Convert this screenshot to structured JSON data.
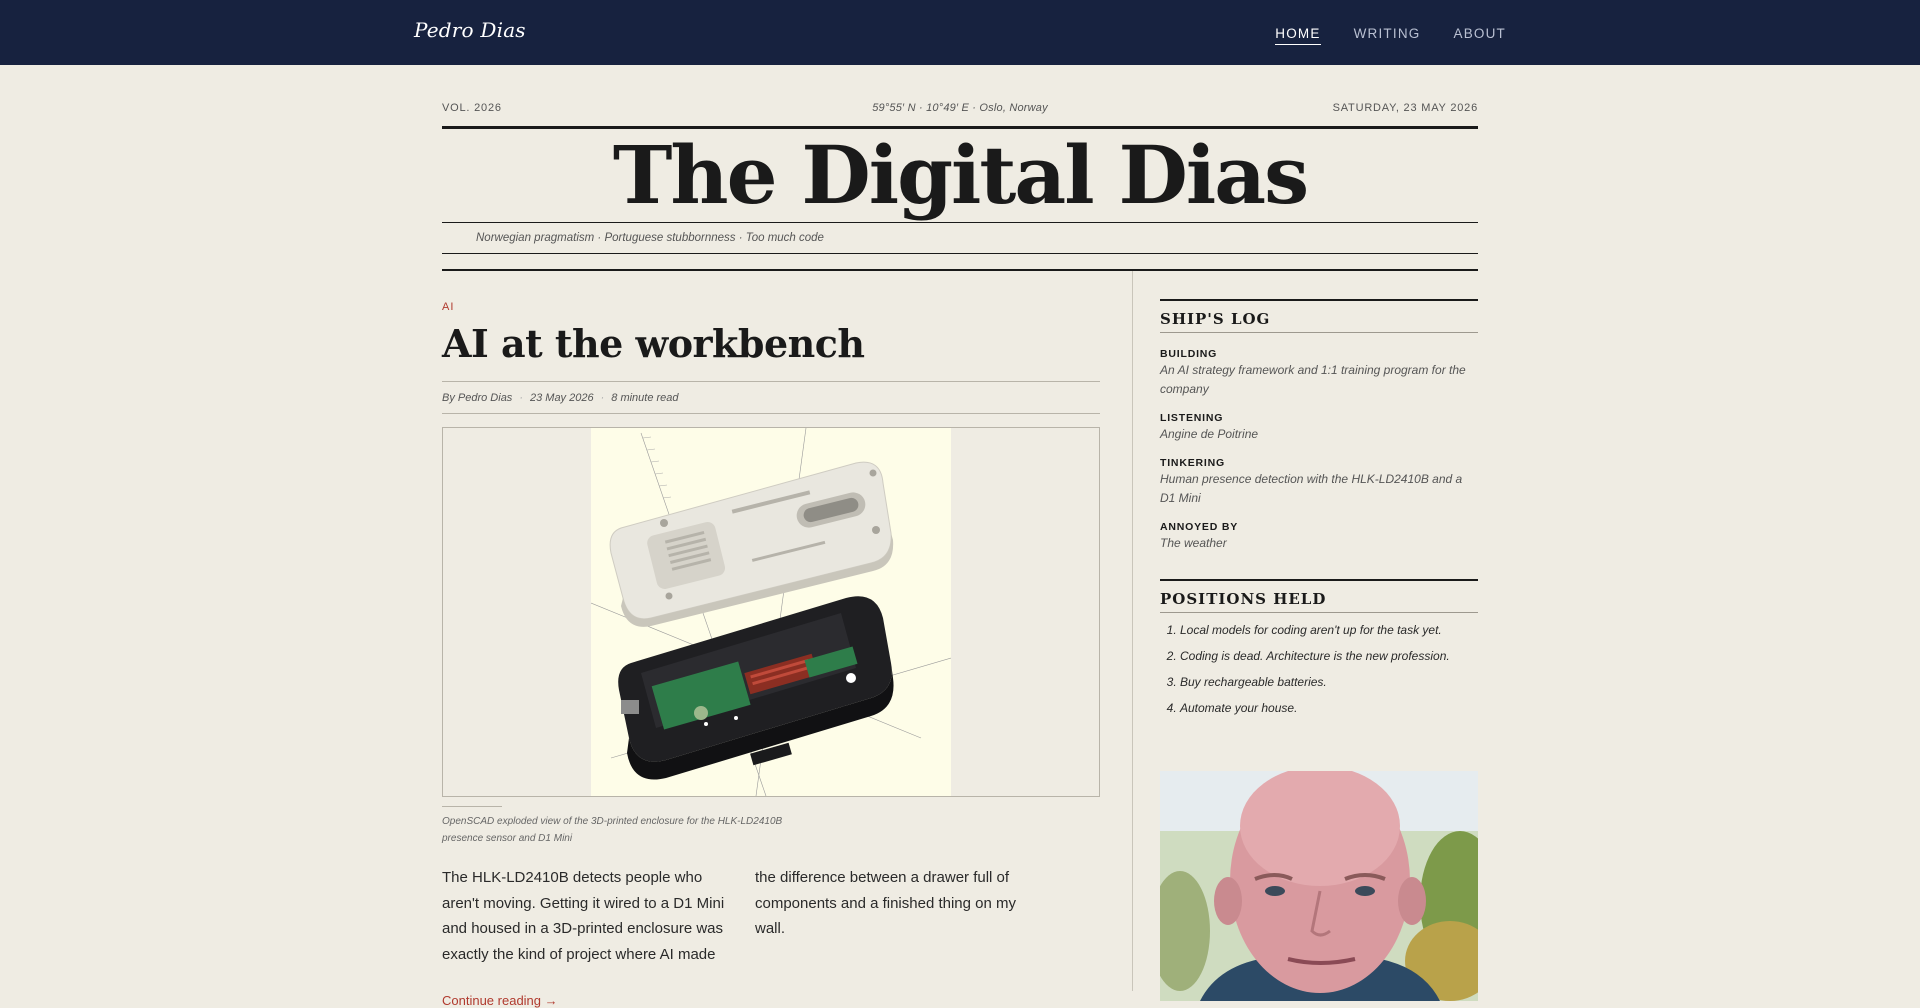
{
  "nav": {
    "brand": "Pedro Dias",
    "links": [
      "HOME",
      "WRITING",
      "ABOUT"
    ],
    "active": "HOME"
  },
  "dateline": {
    "volume": "VOL. 2026",
    "location": "59°55′ N · 10°49′ E · Oslo, Norway",
    "date": "SATURDAY, 23 MAY 2026"
  },
  "masthead": {
    "title": "The Digital Dias",
    "tagline": "Norwegian pragmatism · Portuguese stubbornness · Too much code"
  },
  "article": {
    "category": "AI",
    "title": "AI at the workbench",
    "author": "By Pedro Dias",
    "date": "23 May 2026",
    "read_time": "8 minute read",
    "caption": "OpenSCAD exploded view of the 3D-printed enclosure for the HLK-LD2410B presence sensor and D1 Mini",
    "body": "The HLK-LD2410B detects people who aren't moving. Getting it wired to a D1 Mini and housed in a 3D-printed enclosure was exactly the kind of project where AI made the difference between a drawer full of components and a finished thing on my wall.",
    "read_more": "Continue reading →"
  },
  "sidebar": {
    "ships_log": {
      "title": "SHIP'S LOG",
      "items": [
        {
          "label": "BUILDING",
          "value": "An AI strategy framework and 1:1 training program for the company"
        },
        {
          "label": "LISTENING",
          "value": "Angine de Poitrine"
        },
        {
          "label": "TINKERING",
          "value": "Human presence detection with the HLK-LD2410B and a D1 Mini"
        },
        {
          "label": "ANNOYED BY",
          "value": "The weather"
        }
      ]
    },
    "positions": {
      "title": "POSITIONS HELD",
      "items": [
        "Local models for coding aren't up for the task yet.",
        "Coding is dead. Architecture is the new profession.",
        "Buy rechargeable batteries.",
        "Automate your house."
      ]
    }
  }
}
